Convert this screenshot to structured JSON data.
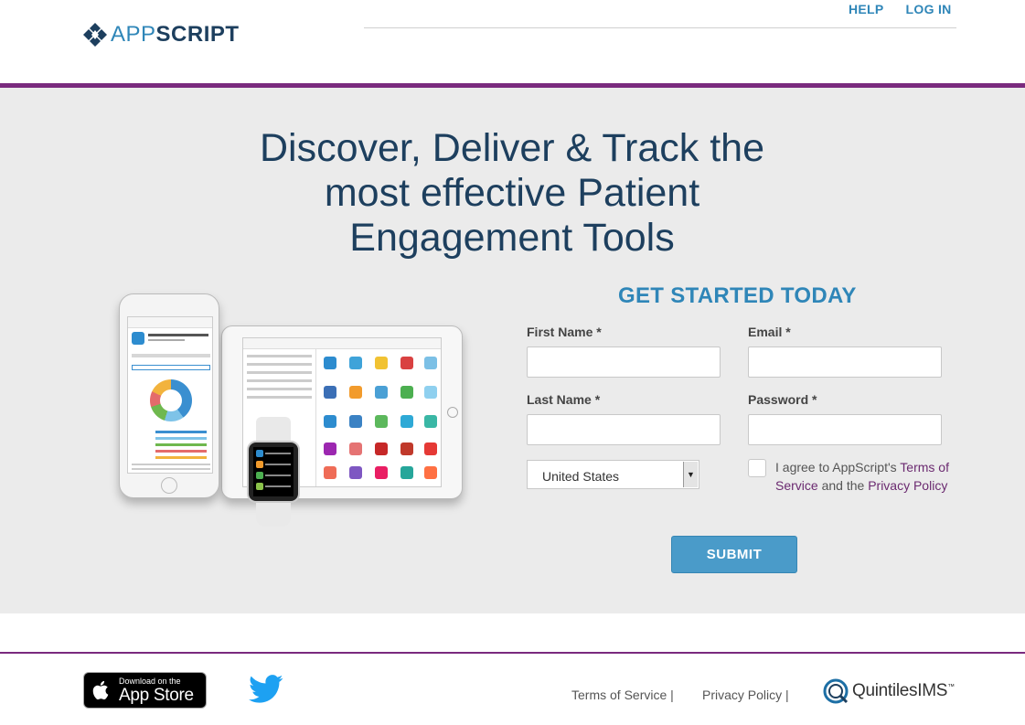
{
  "header": {
    "logo": {
      "app": "APP",
      "script": "SCRIPT",
      "icon": "appscript-diamond-logo"
    },
    "nav": [
      {
        "label": "HELP"
      },
      {
        "label": "LOG IN"
      }
    ]
  },
  "hero": {
    "headline": "Discover, Deliver & Track the most effective Patient Engagement Tools",
    "devices_image": "iphone-ipad-watch-app-screenshots"
  },
  "form": {
    "title": "GET STARTED TODAY",
    "first_name_label": "First Name *",
    "email_label": "Email *",
    "last_name_label": "Last Name *",
    "password_label": "Password *",
    "first_name_value": "",
    "email_value": "",
    "last_name_value": "",
    "password_value": "",
    "country": {
      "selected": "United States"
    },
    "agree": {
      "prefix": "I agree to AppScript's ",
      "terms_link": "Terms of Service",
      "middle": " and the ",
      "privacy_link": "Privacy Policy",
      "checked": false
    },
    "submit_label": "SUBMIT"
  },
  "footer": {
    "appstore": {
      "small": "Download on the",
      "big": "App Store"
    },
    "links": [
      {
        "label": "Terms of Service |"
      },
      {
        "label": "Privacy Policy |"
      }
    ],
    "partner": {
      "name": "QuintilesIMS",
      "tm": "™"
    }
  },
  "colors": {
    "brand_blue": "#2f86b8",
    "brand_navy": "#1d3f5e",
    "accent_purple": "#7a2a7e",
    "hero_bg": "#ebebeb",
    "submit_bg": "#4a9bc9"
  }
}
